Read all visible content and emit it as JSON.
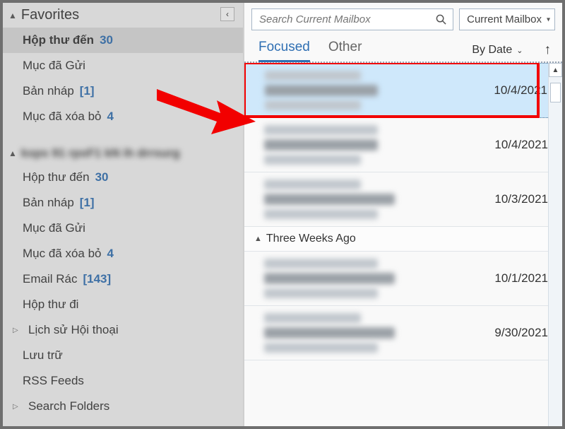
{
  "favorites": {
    "title": "Favorites",
    "items": [
      {
        "label": "Hộp thư đến",
        "count": "30"
      },
      {
        "label": "Mục đã Gửi"
      },
      {
        "label": "Bản nháp",
        "count": "[1]"
      },
      {
        "label": "Mục đã xóa bỏ",
        "count": "4"
      }
    ]
  },
  "accountHeader": "kxps 91 rpxF1 kN ih drrsurg",
  "folders": [
    {
      "label": "Hộp thư đến",
      "count": "30"
    },
    {
      "label": "Bản nháp",
      "count": "[1]"
    },
    {
      "label": "Mục đã Gửi"
    },
    {
      "label": "Mục đã xóa bỏ",
      "count": "4"
    },
    {
      "label": "Email Rác",
      "count": "[143]"
    },
    {
      "label": "Hộp thư đi"
    },
    {
      "label": "Lịch sử Hội thoại",
      "expandable": true
    },
    {
      "label": "Lưu trữ"
    },
    {
      "label": "RSS Feeds"
    },
    {
      "label": "Search Folders",
      "expandable": true
    }
  ],
  "search": {
    "placeholder": "Search Current Mailbox"
  },
  "scope": {
    "label": "Current Mailbox"
  },
  "tabs": {
    "focused": "Focused",
    "other": "Other"
  },
  "sort": {
    "label": "By Date"
  },
  "groupHeader": "Three Weeks Ago",
  "messages": [
    {
      "date": "10/4/2021",
      "selected": true
    },
    {
      "date": "10/4/2021"
    },
    {
      "date": "10/3/2021"
    },
    {
      "group": true
    },
    {
      "date": "10/1/2021"
    },
    {
      "date": "9/30/2021"
    }
  ]
}
